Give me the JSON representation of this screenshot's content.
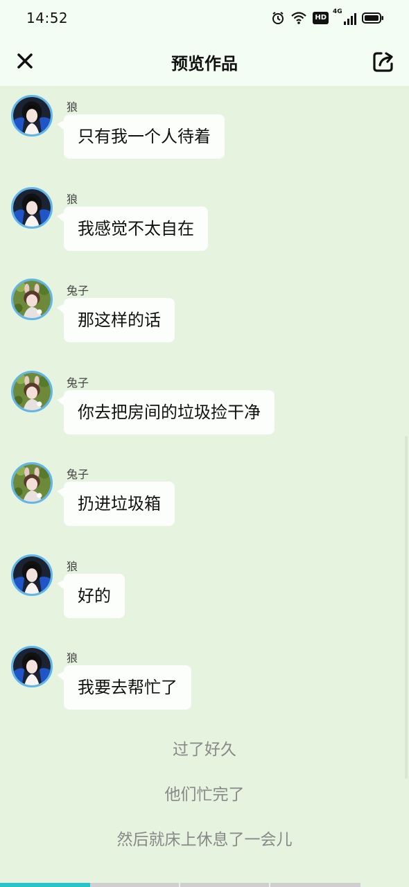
{
  "status_bar": {
    "time": "14:52",
    "hd_label": "HD",
    "network": "4G"
  },
  "header": {
    "title": "预览作品",
    "close_icon": "close-icon",
    "share_icon": "share-icon"
  },
  "messages": [
    {
      "sender": "狼",
      "avatar": "wolf",
      "text": "只有我一个人待着"
    },
    {
      "sender": "狼",
      "avatar": "wolf",
      "text": "我感觉不太自在"
    },
    {
      "sender": "兔子",
      "avatar": "rabbit",
      "text": "那这样的话"
    },
    {
      "sender": "兔子",
      "avatar": "rabbit",
      "text": "你去把房间的垃圾捡干净"
    },
    {
      "sender": "兔子",
      "avatar": "rabbit",
      "text": "扔进垃圾箱"
    },
    {
      "sender": "狼",
      "avatar": "wolf",
      "text": "好的"
    },
    {
      "sender": "狼",
      "avatar": "wolf",
      "text": "我要去帮忙了"
    }
  ],
  "narration": [
    "过了好久",
    "他们忙完了",
    "然后就床上休息了一会儿"
  ],
  "progress": {
    "segments": 4,
    "progress_fraction": 0.22
  },
  "colors": {
    "background": "#e5f3df",
    "header_bg": "#f4fdf3",
    "bubble_bg": "#fbfefa",
    "avatar_ring": "#5fb6ea",
    "progress_fill": "#28c3c7"
  }
}
